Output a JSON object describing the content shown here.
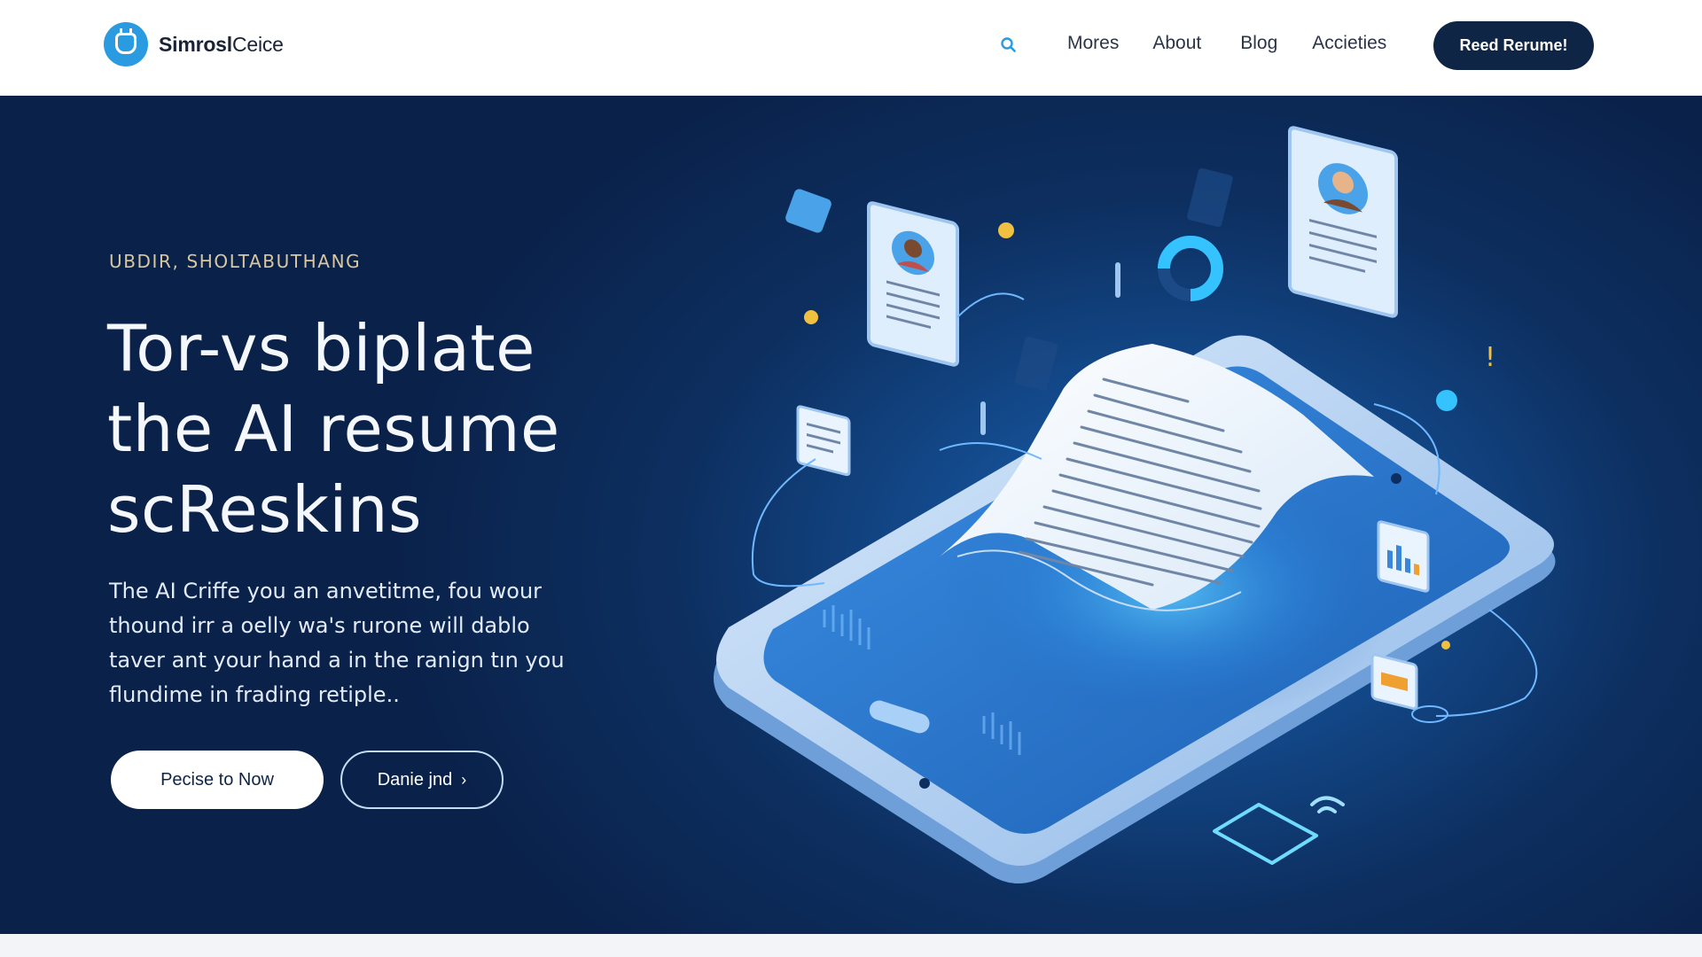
{
  "brand": {
    "name_bold": "Simrosl",
    "name_rest": "Ceice",
    "logo_icon": "robot-badge-icon"
  },
  "nav": {
    "search_icon": "search-icon",
    "links": [
      "Mores",
      "About",
      "Blog",
      "Accieties"
    ],
    "cta_label": "Reed Rerume!"
  },
  "hero": {
    "eyebrow": "UBDIR, SHOLTABUTHANG",
    "headline_lines": [
      "Tor-vs biplate",
      "the AI resume",
      "scReskins"
    ],
    "body_lines": [
      "The AI Criffe you  an anvetitme, fou wour",
      "thound irr a oelly wa's rurone will dablo",
      "taver ant your hand a in the ranign tın you",
      "flundime in frading retiple.."
    ],
    "primary_button": "Pecise to Now",
    "secondary_button": "Danie jnd",
    "secondary_icon": "chevron-right-icon"
  },
  "colors": {
    "nav_bg": "#ffffff",
    "hero_bg": "#0d2f60",
    "accent": "#2a9be0",
    "cta_bg": "#0f2545",
    "eyebrow": "#d8c79f"
  },
  "illustration": {
    "name": "isometric-tablet-resume-illustration",
    "icons": [
      "tablet-icon",
      "document-icon",
      "profile-card-icon",
      "chart-icon",
      "donut-chart-icon",
      "wifi-icon"
    ]
  }
}
